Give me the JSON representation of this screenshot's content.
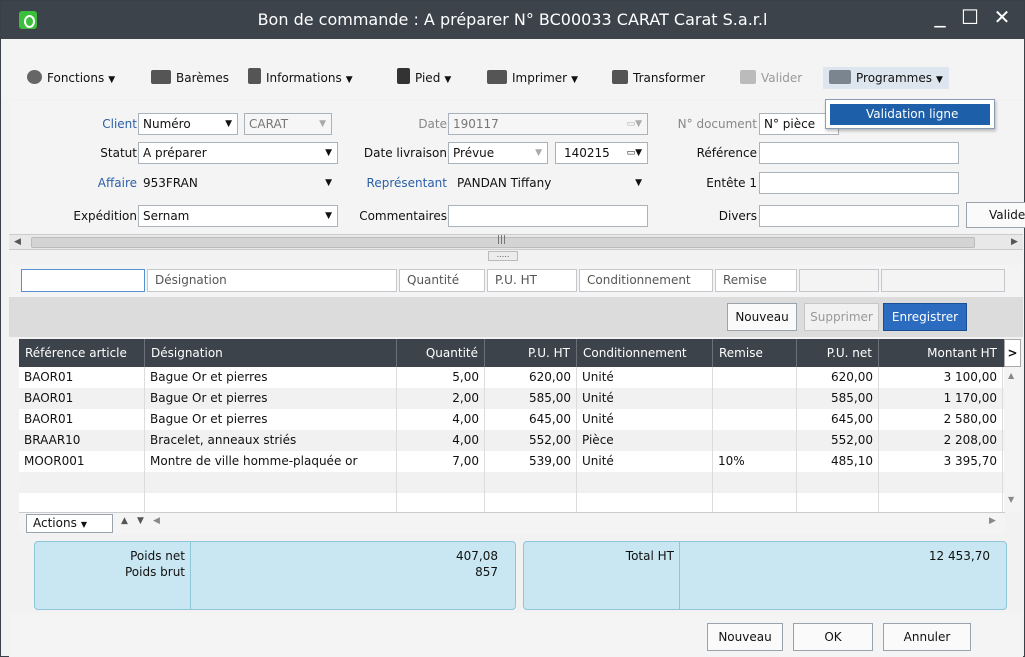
{
  "window": {
    "title": "Bon de commande : A préparer N° BC00033 CARAT Carat S.a.r.l",
    "minimize": "_",
    "maximize": "☐",
    "close": "✕"
  },
  "toolbar": {
    "fonctions": "Fonctions",
    "baremes": "Barèmes",
    "informations": "Informations",
    "pied": "Pied",
    "imprimer": "Imprimer",
    "transformer": "Transformer",
    "valider": "Valider",
    "programmes": "Programmes"
  },
  "menu": {
    "items": [
      "Validation ligne"
    ]
  },
  "form": {
    "client_label": "Client",
    "client_type": "Numéro",
    "client_value": "CARAT",
    "date_label": "Date",
    "date_value": "190117",
    "ndoc_label": "N° document",
    "ndoc_value": "N° pièce",
    "statut_label": "Statut",
    "statut_value": "A préparer",
    "date_livraison_label": "Date livraison",
    "date_livraison_type": "Prévue",
    "date_livraison_value": "140215",
    "reference_label": "Référence",
    "affaire_label": "Affaire",
    "affaire_value": "953FRAN",
    "representant_label": "Représentant",
    "representant_value": "PANDAN Tiffany",
    "entete_label": "Entête 1",
    "expedition_label": "Expédition",
    "expedition_value": "Sernam",
    "commentaires_label": "Commentaires",
    "divers_label": "Divers",
    "valide_button": "Valide"
  },
  "scrollbar": {
    "grip": "|||",
    "splitter": "....."
  },
  "filters": {
    "designation": "Désignation",
    "quantite": "Quantité",
    "pu_ht": "P.U. HT",
    "conditionnement": "Conditionnement",
    "remise": "Remise"
  },
  "line_actions": {
    "nouveau": "Nouveau",
    "supprimer": "Supprimer",
    "enregistrer": "Enregistrer"
  },
  "grid": {
    "columns": [
      "Référence article",
      "Désignation",
      "Quantité",
      "P.U. HT",
      "Conditionnement",
      "Remise",
      "P.U. net",
      "Montant HT"
    ],
    "rows": [
      [
        "BAOR01",
        "Bague Or et pierres",
        "5,00",
        "620,00",
        "Unité",
        "",
        "620,00",
        "3 100,00"
      ],
      [
        "BAOR01",
        "Bague Or et pierres",
        "2,00",
        "585,00",
        "Unité",
        "",
        "585,00",
        "1 170,00"
      ],
      [
        "BAOR01",
        "Bague Or et pierres",
        "4,00",
        "645,00",
        "Unité",
        "",
        "645,00",
        "2 580,00"
      ],
      [
        "BRAAR10",
        "Bracelet, anneaux striés",
        "4,00",
        "552,00",
        "Pièce",
        "",
        "552,00",
        "2 208,00"
      ],
      [
        "MOOR001",
        "Montre de ville homme-plaquée or",
        "7,00",
        "539,00",
        "Unité",
        "10%",
        "485,10",
        "3 395,70"
      ]
    ],
    "actions_label": "Actions"
  },
  "totals": {
    "poids_net_label": "Poids net",
    "poids_brut_label": "Poids brut",
    "poids_net": "407,08",
    "poids_brut": "857",
    "total_ht_label": "Total HT",
    "total_ht": "12 453,70"
  },
  "footer": {
    "nouveau": "Nouveau",
    "ok": "OK",
    "annuler": "Annuler"
  }
}
